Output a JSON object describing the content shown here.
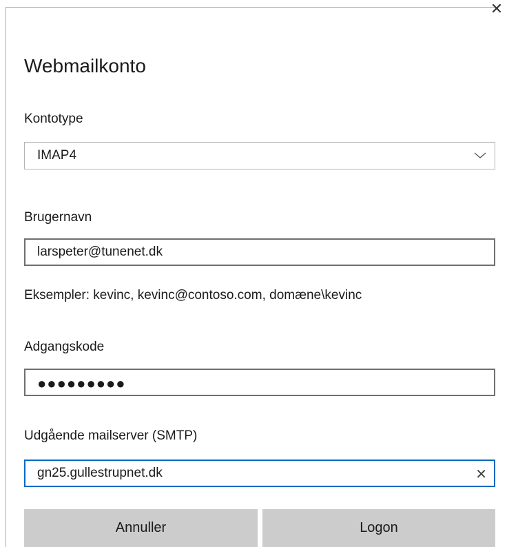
{
  "dialog": {
    "close_glyph": "✕",
    "title": "Webmailkonto"
  },
  "account_type": {
    "label": "Kontotype",
    "value": "IMAP4"
  },
  "username": {
    "label": "Brugernavn",
    "value": "larspeter@tunenet.dk",
    "hint": "Eksempler: kevinc, kevinc@contoso.com, domæne\\kevinc"
  },
  "password": {
    "label": "Adgangskode",
    "value": "●●●●●●●●●"
  },
  "smtp": {
    "label": "Udgående mailserver (SMTP)",
    "value": "gn25.gullestrupnet.dk",
    "clear_glyph": "✕"
  },
  "buttons": {
    "cancel_label": "Annuller",
    "logon_label": "Logon"
  },
  "colors": {
    "focus_border": "#0a69c4",
    "button_bg": "#cccccc"
  }
}
